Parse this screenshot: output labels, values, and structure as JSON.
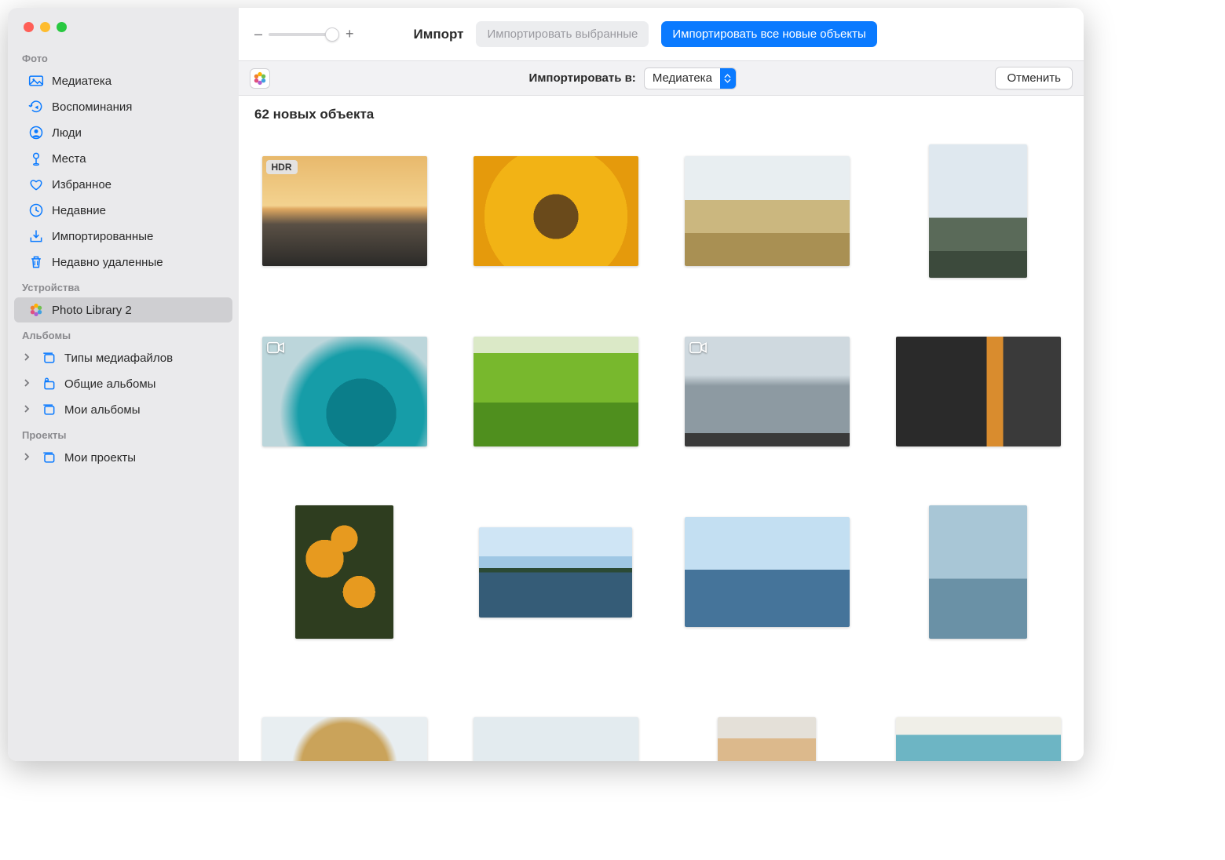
{
  "toolbar": {
    "title": "Импорт",
    "import_selected_label": "Импортировать выбранные",
    "import_all_label": "Импортировать все новые объекты",
    "zoom_minus": "–",
    "zoom_plus": "+"
  },
  "subbar": {
    "import_to_label": "Импортировать в:",
    "destination_value": "Медиатека",
    "cancel_label": "Отменить"
  },
  "content": {
    "count_label": "62 новых объекта"
  },
  "thumbs": [
    {
      "shape": "landscape",
      "paint": "p-sunset",
      "badge": "HDR"
    },
    {
      "shape": "landscape",
      "paint": "p-sunflower"
    },
    {
      "shape": "landscape",
      "paint": "p-hills"
    },
    {
      "shape": "portrait",
      "paint": "p-mountains"
    },
    {
      "shape": "landscape",
      "paint": "p-tealsmoke",
      "video": true
    },
    {
      "shape": "landscape",
      "paint": "p-ricefield"
    },
    {
      "shape": "landscape",
      "paint": "p-skyscraper",
      "video": true
    },
    {
      "shape": "landscape",
      "paint": "p-bike"
    },
    {
      "shape": "portrait",
      "paint": "p-flowers"
    },
    {
      "shape": "small-land",
      "paint": "p-lake"
    },
    {
      "shape": "landscape",
      "paint": "p-water"
    },
    {
      "shape": "portrait",
      "paint": "p-wade"
    },
    {
      "shape": "landscape",
      "paint": "p-hair"
    },
    {
      "shape": "landscape",
      "paint": "p-tree"
    },
    {
      "shape": "portrait",
      "paint": "p-portrait"
    },
    {
      "shape": "landscape",
      "paint": "p-pool"
    }
  ],
  "sidebar": {
    "sections": [
      {
        "label": "Фото",
        "items": [
          {
            "name": "library",
            "label": "Медиатека",
            "icon": "photo"
          },
          {
            "name": "memories",
            "label": "Воспоминания",
            "icon": "memories"
          },
          {
            "name": "people",
            "label": "Люди",
            "icon": "person"
          },
          {
            "name": "places",
            "label": "Места",
            "icon": "pin"
          },
          {
            "name": "favorites",
            "label": "Избранное",
            "icon": "heart"
          },
          {
            "name": "recent",
            "label": "Недавние",
            "icon": "clock"
          },
          {
            "name": "imports",
            "label": "Импортированные",
            "icon": "download"
          },
          {
            "name": "trash",
            "label": "Недавно удаленные",
            "icon": "trash"
          }
        ]
      },
      {
        "label": "Устройства",
        "items": [
          {
            "name": "device-photo-library-2",
            "label": "Photo Library 2",
            "icon": "flower",
            "selected": true
          }
        ]
      },
      {
        "label": "Альбомы",
        "items": [
          {
            "name": "media-types",
            "label": "Типы медиафайлов",
            "icon": "album",
            "chevron": true
          },
          {
            "name": "shared-albums",
            "label": "Общие альбомы",
            "icon": "shared",
            "chevron": true
          },
          {
            "name": "my-albums",
            "label": "Мои альбомы",
            "icon": "album",
            "chevron": true
          }
        ]
      },
      {
        "label": "Проекты",
        "items": [
          {
            "name": "my-projects",
            "label": "Мои проекты",
            "icon": "album",
            "chevron": true
          }
        ]
      }
    ]
  }
}
